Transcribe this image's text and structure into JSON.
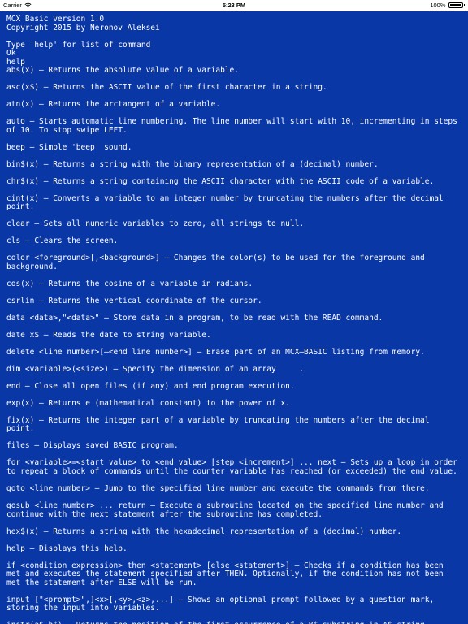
{
  "status_bar": {
    "carrier": "Carrier",
    "time": "5:23 PM",
    "battery": "100%",
    "battery_level": 1.0
  },
  "terminal": {
    "background_color": "#0a37a6",
    "text_color": "#ffffff",
    "header": [
      "MCX Basic version 1.0",
      "Copyright 2015 by Neronov Aleksei"
    ],
    "prompt_hint": "Type 'help' for list of command",
    "ok": "Ok",
    "command": "help",
    "entries": [
      "abs(x) – Returns the absolute value of a variable.",
      "asc(x$) – Returns the ASCII value of the first character in a string.",
      "atn(x) – Returns the arctangent of a variable.",
      "auto – Starts automatic line numbering. The line number will start with 10, incrementing in steps of 10. To stop swipe LEFT.",
      "beep – Simple 'beep' sound.",
      "bin$(x) – Returns a string with the binary representation of a (decimal) number.",
      "chr$(x) – Returns a string containing the ASCII character with the ASCII code of a variable.",
      "cint(x) – Converts a variable to an integer number by truncating the numbers after the decimal point.",
      "clear – Sets all numeric variables to zero, all strings to null.",
      "cls – Clears the screen.",
      "color <foreground>[,<background>] – Changes the color(s) to be used for the foreground and background.",
      "cos(x) – Returns the cosine of a variable in radians.",
      "csrlin – Returns the vertical coordinate of the cursor.",
      "data <data>,\"<data>\" – Store data in a program, to be read with the READ command.",
      "date x$ – Reads the date to string variable.",
      "delete <line number>[–<end line number>] – Erase part of an MCX–BASIC listing from memory.",
      "dim <variable>(<size>) – Specify the dimension of an array     .",
      "end – Close all open files (if any) and end program execution.",
      "exp(x) – Returns e (mathematical constant) to the power of x.",
      "fix(x) – Returns the integer part of a variable by truncating the numbers after the decimal point.",
      "files – Displays saved BASIC program.",
      "for <variable>=<start value> to <end value> [step <increment>] ... next – Sets up a loop in order to repeat a block of commands until the counter variable has reached (or exceeded) the end value.",
      "goto <line number> – Jump to the specified line number and execute the commands from there.",
      "gosub <line number> ... return – Execute a subroutine located on the specified line number and continue with the next statement after the subroutine has completed.",
      "hex$(x) – Returns a string with the hexadecimal representation of a (decimal) number.",
      "help – Displays this help.",
      "if <condition expression> then <statement> [else <statement>] – Checks if a condition has been met and executes the statement specified after THEN. Optionally, if the condition has not been met the statement after ELSE will be run.",
      "input [\"<prompt>\",]<x>[,<y>,<z>,...] – Shows an optional prompt followed by a question mark, storing the input into variables.",
      "instr(a$,b$) – Returns the position of the first occurrence of a B$ substring in A$ string."
    ]
  }
}
